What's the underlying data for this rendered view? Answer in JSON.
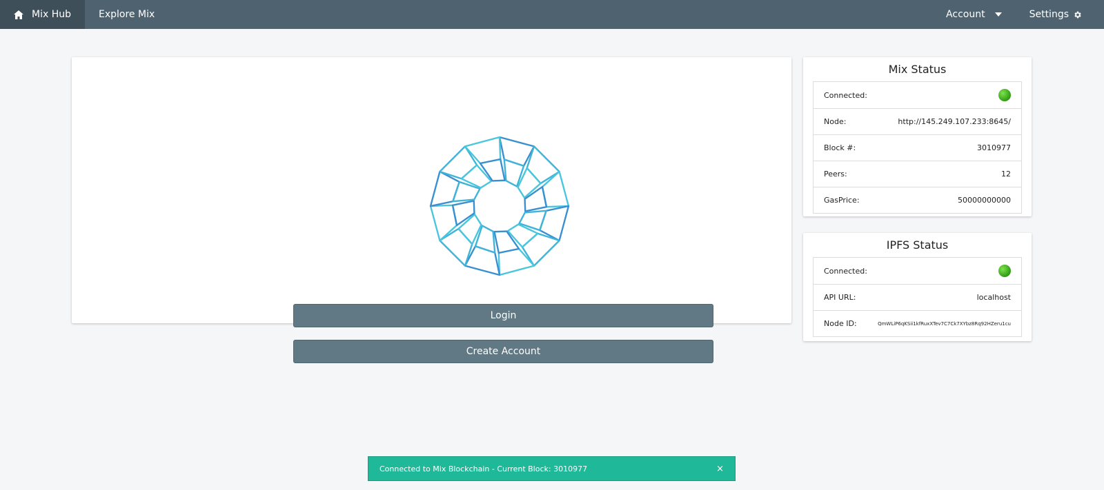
{
  "nav": {
    "home_label": "Mix Hub",
    "explore_label": "Explore Mix",
    "account_label": "Account",
    "settings_label": "Settings"
  },
  "main": {
    "login_label": "Login",
    "create_label": "Create Account"
  },
  "mix_status": {
    "title": "Mix Status",
    "rows": [
      {
        "label": "Connected:",
        "value": ""
      },
      {
        "label": "Node:",
        "value": "http://145.249.107.233:8645/"
      },
      {
        "label": "Block #:",
        "value": "3010977"
      },
      {
        "label": "Peers:",
        "value": "12"
      },
      {
        "label": "GasPrice:",
        "value": "50000000000"
      }
    ]
  },
  "ipfs_status": {
    "title": "IPFS Status",
    "rows": [
      {
        "label": "Connected:",
        "value": ""
      },
      {
        "label": "API URL:",
        "value": "localhost"
      },
      {
        "label": "Node ID:",
        "value": "QmWLiP6qKSii1kfRuxXTev7C7Ck7XYbz8Rq92HZeru1cu"
      }
    ]
  },
  "toast": {
    "message": "Connected to Mix Blockchain - Current Block: 3010977",
    "close": "×"
  },
  "colors": {
    "navbar": "#4f6270",
    "button": "#607985",
    "toast": "#1fb99a",
    "status_ok": "#3aa819"
  },
  "icons": {
    "home": "home-icon",
    "caret": "caret-down-icon",
    "settings": "gear-icon",
    "status": "status-dot-icon",
    "logo": "mix-logo-icon",
    "close": "close-icon"
  }
}
